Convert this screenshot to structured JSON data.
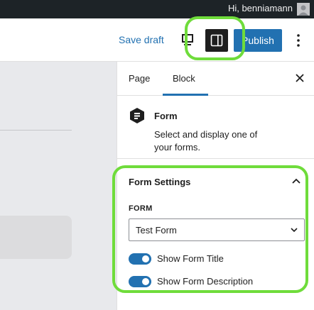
{
  "admin_bar": {
    "greeting": "Hi, benniamann"
  },
  "toolbar": {
    "save_draft": "Save draft",
    "publish": "Publish",
    "icons": [
      "preview-icon",
      "settings-sidebar-icon",
      "more-options-icon"
    ]
  },
  "sidebar": {
    "tabs": [
      {
        "label": "Page"
      },
      {
        "label": "Block",
        "active": true
      }
    ],
    "block": {
      "name": "Form",
      "description": "Select and display one of your forms."
    },
    "panel": {
      "title": "Form Settings",
      "form_label": "FORM",
      "form_value": "Test Form",
      "toggles": [
        {
          "label": "Show Form Title",
          "on": true
        },
        {
          "label": "Show Form Description",
          "on": true
        }
      ]
    }
  },
  "colors": {
    "accent": "#2271b1",
    "highlight": "#6fdc3b",
    "admin_bar": "#1d2327"
  }
}
